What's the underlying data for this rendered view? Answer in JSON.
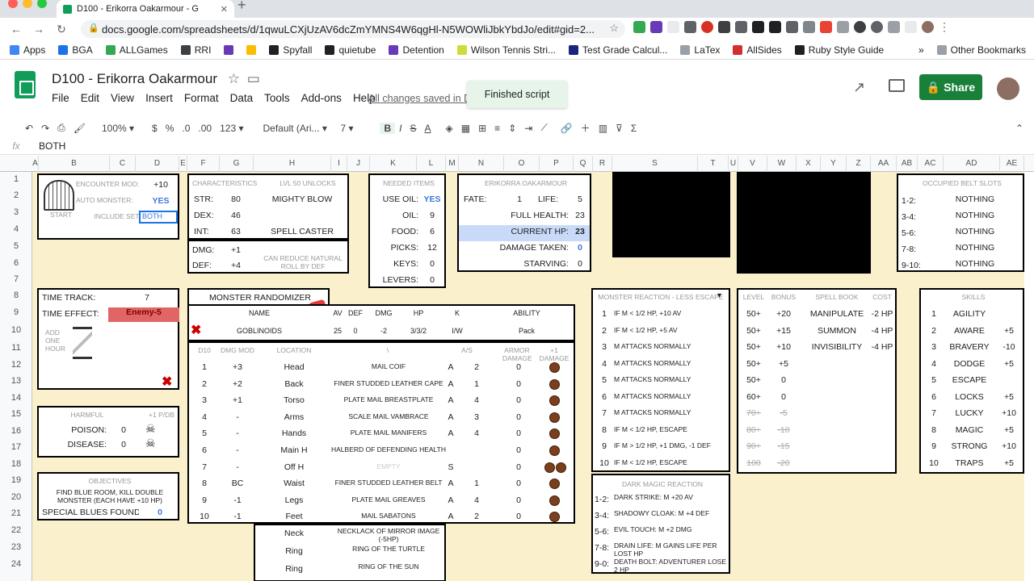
{
  "browser": {
    "tab_title": "D100 - Erikorra Oakarmour - G",
    "url": "docs.google.com/spreadsheets/d/1qwuLCXjUzAV6dcZmYMNS4W6qgHl-N5WOWliJbkYbdJo/edit#gid=2..."
  },
  "bookmarks": [
    {
      "label": "Apps",
      "color": "#4285f4"
    },
    {
      "label": "BGA",
      "color": "#1a73e8"
    },
    {
      "label": "ALLGames",
      "color": "#34a853"
    },
    {
      "label": "RRI",
      "color": "#3c4043"
    },
    {
      "label": "",
      "color": "#673ab7"
    },
    {
      "label": "",
      "color": "#fbbc04"
    },
    {
      "label": "Spyfall",
      "color": "#202124"
    },
    {
      "label": "quietube",
      "color": "#202124"
    },
    {
      "label": "Detention",
      "color": "#673ab7"
    },
    {
      "label": "Wilson Tennis Stri...",
      "color": "#cddc39"
    },
    {
      "label": "Test Grade Calcul...",
      "color": "#1a237e"
    },
    {
      "label": "LaTex",
      "color": "#9aa0a6"
    },
    {
      "label": "AllSides",
      "color": "#d32f2f"
    },
    {
      "label": "Ruby Style Guide",
      "color": "#202124"
    }
  ],
  "bookmarks_more": "»",
  "other_bookmarks": "Other Bookmarks",
  "doc": {
    "title": "D100 - Erikorra Oakarmour",
    "menus": [
      "File",
      "Edit",
      "View",
      "Insert",
      "Format",
      "Data",
      "Tools",
      "Add-ons",
      "Help"
    ],
    "saved": "All changes saved in D",
    "toast": "Finished script",
    "share": "Share"
  },
  "toolbar": {
    "zoom": "100%",
    "currency": "$",
    "percent": "%",
    "dec1": ".0",
    "dec2": ".00",
    "fmt": "123",
    "font": "Default (Ari...",
    "size": "7",
    "bold": "B",
    "italic": "I",
    "strike": "S",
    "color": "A"
  },
  "formula": {
    "fx": "fx",
    "value": "BOTH"
  },
  "columns": [
    "A",
    "B",
    "C",
    "D",
    "E",
    "F",
    "G",
    "H",
    "I",
    "J",
    "K",
    "L",
    "M",
    "N",
    "O",
    "P",
    "Q",
    "R",
    "S",
    "T",
    "U",
    "V",
    "W",
    "X",
    "Y",
    "Z",
    "AA",
    "AB",
    "AC",
    "AD",
    "AE"
  ],
  "rows": [
    "1",
    "2",
    "3",
    "4",
    "5",
    "6",
    "7",
    "8",
    "9",
    "10",
    "11",
    "12",
    "13",
    "14",
    "15",
    "16",
    "17",
    "18",
    "19",
    "20",
    "21",
    "22",
    "23",
    "24"
  ],
  "start": {
    "enc_mod_label": "ENCOUNTER MOD:",
    "enc_mod": "+10",
    "auto_label": "AUTO MONSTER:",
    "auto": "YES",
    "include_label": "INCLUDE SET:",
    "include": "BOTH",
    "door_label": "START"
  },
  "chars": {
    "header": "CHARACTERISTICS",
    "unlocks": "LVL 50 UNLOCKS",
    "str_l": "STR:",
    "str": "80",
    "str_u": "MIGHTY BLOW",
    "dex_l": "DEX:",
    "dex": "46",
    "int_l": "INT:",
    "int": "63",
    "int_u": "SPELL CASTER",
    "dmg_l": "DMG:",
    "dmg": "+1",
    "def_l": "DEF:",
    "def": "+4",
    "note": "CAN REDUCE NATURAL ROLL BY DEF"
  },
  "items": {
    "header": "NEEDED ITEMS",
    "useoil_l": "USE OIL:",
    "useoil": "YES",
    "oil_l": "OIL:",
    "oil": "9",
    "food_l": "FOOD:",
    "food": "6",
    "picks_l": "PICKS:",
    "picks": "12",
    "keys_l": "KEYS:",
    "keys": "0",
    "levers_l": "LEVERS:",
    "levers": "0"
  },
  "hero": {
    "header": "ERIKORRA OAKARMOUR",
    "fate_l": "FATE:",
    "fate": "1",
    "life_l": "LIFE:",
    "life": "5",
    "fh_l": "FULL HEALTH:",
    "fh": "23",
    "ch_l": "CURRENT HP:",
    "ch": "23",
    "dt_l": "DAMAGE TAKEN:",
    "dt": "0",
    "st_l": "STARVING:",
    "st": "0"
  },
  "belt": {
    "header": "OCCUPIED BELT SLOTS",
    "slots": [
      {
        "k": "1-2:",
        "v": "NOTHING"
      },
      {
        "k": "3-4:",
        "v": "NOTHING"
      },
      {
        "k": "5-6:",
        "v": "NOTHING"
      },
      {
        "k": "7-8:",
        "v": "NOTHING"
      },
      {
        "k": "9-10:",
        "v": "NOTHING"
      }
    ]
  },
  "time": {
    "track_l": "TIME TRACK:",
    "track": "7",
    "effect_l": "TIME EFFECT:",
    "effect": "Enemy-5",
    "hour_note": "ADD ONE HOUR"
  },
  "harmful": {
    "header": "HARMFUL",
    "pdb": "+1 P/DB",
    "poison_l": "POISON:",
    "poison": "0",
    "disease_l": "DISEASE:",
    "disease": "0"
  },
  "objectives": {
    "header": "OBJECTIVES",
    "text": "FIND BLUE ROOM, KILL DOUBLE MONSTER (EACH HAVE +10 HP)",
    "blues_l": "SPECIAL BLUES FOUND:",
    "blues": "0"
  },
  "monster": {
    "title": "MONSTER RANDOMIZER",
    "h_name": "NAME",
    "h_av": "AV",
    "h_def": "DEF",
    "h_dmg": "DMG",
    "h_hp": "HP",
    "h_k": "K",
    "h_ability": "ABILITY",
    "name": "GOBLINOIDS",
    "av": "25",
    "def": "0",
    "dmg": "-2",
    "hp": "3/3/2",
    "k": "I/W",
    "ability": "Pack"
  },
  "armor": {
    "h_d10": "D10",
    "h_mod": "DMG MOD",
    "h_loc": "LOCATION",
    "h_item": "\\",
    "h_as": "A/S",
    "h_ad": "ARMOR DAMAGE",
    "h_p1": "+1 DAMAGE",
    "rows": [
      {
        "d": "1",
        "m": "+3",
        "l": "Head",
        "i": "MAIL COIF",
        "a": "A",
        "n": "2",
        "z": "0"
      },
      {
        "d": "2",
        "m": "+2",
        "l": "Back",
        "i": "FINER STUDDED LEATHER CAPE",
        "a": "A",
        "n": "1",
        "z": "0"
      },
      {
        "d": "3",
        "m": "+1",
        "l": "Torso",
        "i": "PLATE MAIL BREASTPLATE",
        "a": "A",
        "n": "4",
        "z": "0"
      },
      {
        "d": "4",
        "m": "-",
        "l": "Arms",
        "i": "SCALE MAIL VAMBRACE",
        "a": "A",
        "n": "3",
        "z": "0"
      },
      {
        "d": "5",
        "m": "-",
        "l": "Hands",
        "i": "PLATE MAIL MANIFERS",
        "a": "A",
        "n": "4",
        "z": "0"
      },
      {
        "d": "6",
        "m": "-",
        "l": "Main H",
        "i": "HALBERD OF DEFENDING HEALTH",
        "a": "",
        "n": "",
        "z": "0"
      },
      {
        "d": "7",
        "m": "-",
        "l": "Off H",
        "i": "EMPTY",
        "a": "S",
        "n": "",
        "z": "0"
      },
      {
        "d": "8",
        "m": "BC",
        "l": "Waist",
        "i": "FINER STUDDED LEATHER BELT",
        "a": "A",
        "n": "1",
        "z": "0"
      },
      {
        "d": "9",
        "m": "-1",
        "l": "Legs",
        "i": "PLATE MAIL GREAVES",
        "a": "A",
        "n": "4",
        "z": "0"
      },
      {
        "d": "10",
        "m": "-1",
        "l": "Feet",
        "i": "MAIL SABATONS",
        "a": "A",
        "n": "2",
        "z": "0"
      }
    ],
    "extra": [
      {
        "l": "Neck",
        "i": "NECKLACK OF MIRROR IMAGE (-5HP)"
      },
      {
        "l": "Ring",
        "i": "RING OF THE TURTLE"
      },
      {
        "l": "Ring",
        "i": "RING OF THE SUN"
      }
    ]
  },
  "reaction": {
    "header": "MONSTER REACTION - LESS ESCAPE",
    "rows": [
      {
        "n": "1",
        "t": "IF M < 1/2 HP, +10 AV"
      },
      {
        "n": "2",
        "t": "IF M < 1/2 HP, +5 AV"
      },
      {
        "n": "3",
        "t": "M ATTACKS NORMALLY"
      },
      {
        "n": "4",
        "t": "M ATTACKS NORMALLY"
      },
      {
        "n": "5",
        "t": "M ATTACKS NORMALLY"
      },
      {
        "n": "6",
        "t": "M ATTACKS NORMALLY"
      },
      {
        "n": "7",
        "t": "M ATTACKS NORMALLY"
      },
      {
        "n": "8",
        "t": "IF M < 1/2 HP, ESCAPE"
      },
      {
        "n": "9",
        "t": "IF M > 1/2 HP, +1 DMG, -1 DEF"
      },
      {
        "n": "10",
        "t": "IF M < 1/2 HP, ESCAPE"
      }
    ]
  },
  "dark": {
    "header": "DARK MAGIC REACTION",
    "rows": [
      {
        "k": "1-2:",
        "t": "DARK STRIKE: M +20 AV"
      },
      {
        "k": "3-4:",
        "t": "SHADOWY CLOAK: M +4 DEF"
      },
      {
        "k": "5-6:",
        "t": "EVIL TOUCH: M +2 DMG"
      },
      {
        "k": "7-8:",
        "t": "DRAIN LIFE: M GAINS LIFE PER LOST HP"
      },
      {
        "k": "9-0:",
        "t": "DEATH BOLT: ADVENTURER LOSE 2 HP"
      }
    ]
  },
  "levels": {
    "h_level": "LEVEL",
    "h_bonus": "BONUS",
    "h_spell": "SPELL BOOK",
    "h_cost": "COST",
    "rows": [
      {
        "l": "50+",
        "b": "+20",
        "s": "MANIPULATE",
        "c": "-2 HP"
      },
      {
        "l": "50+",
        "b": "+15",
        "s": "SUMMON",
        "c": "-4 HP"
      },
      {
        "l": "50+",
        "b": "+10",
        "s": "INVISIBILITY",
        "c": "-4 HP"
      },
      {
        "l": "50+",
        "b": "+5",
        "s": "",
        "c": ""
      },
      {
        "l": "50+",
        "b": "0",
        "s": "",
        "c": ""
      },
      {
        "l": "60+",
        "b": "0",
        "s": "",
        "c": ""
      },
      {
        "l": "70+",
        "b": "-5",
        "s": "",
        "c": ""
      },
      {
        "l": "80+",
        "b": "-10",
        "s": "",
        "c": ""
      },
      {
        "l": "90+",
        "b": "-15",
        "s": "",
        "c": ""
      },
      {
        "l": "100",
        "b": "-20",
        "s": "",
        "c": ""
      }
    ]
  },
  "skills": {
    "header": "SKILLS",
    "rows": [
      {
        "n": "1",
        "s": "AGILITY",
        "b": ""
      },
      {
        "n": "2",
        "s": "AWARE",
        "b": "+5"
      },
      {
        "n": "3",
        "s": "BRAVERY",
        "b": "-10"
      },
      {
        "n": "4",
        "s": "DODGE",
        "b": "+5"
      },
      {
        "n": "5",
        "s": "ESCAPE",
        "b": ""
      },
      {
        "n": "6",
        "s": "LOCKS",
        "b": "+5"
      },
      {
        "n": "7",
        "s": "LUCKY",
        "b": "+10"
      },
      {
        "n": "8",
        "s": "MAGIC",
        "b": "+5"
      },
      {
        "n": "9",
        "s": "STRONG",
        "b": "+10"
      },
      {
        "n": "10",
        "s": "TRAPS",
        "b": "+5"
      }
    ]
  }
}
